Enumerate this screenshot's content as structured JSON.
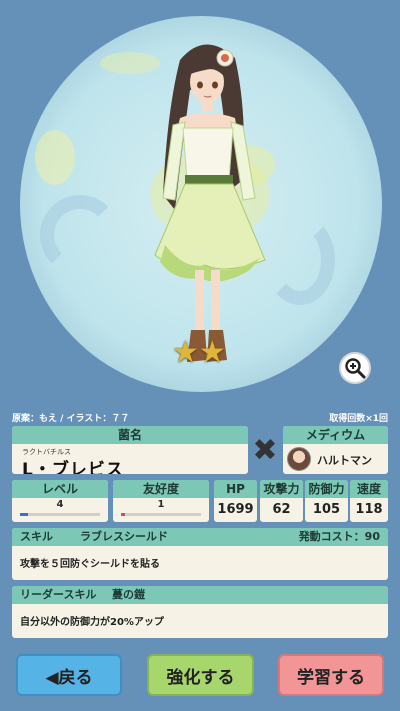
{
  "credits": {
    "left": "原案：もえ / イラスト：７７",
    "right": "取得回数×1回"
  },
  "character": {
    "name_label": "菌名",
    "name_ruby": "ラクトバチルス",
    "name": "L・ブレビス",
    "rarity_stars": 2,
    "stars_text": "★★"
  },
  "medium": {
    "label": "メディウム",
    "name": "ハルトマン"
  },
  "stats": {
    "level": {
      "label": "レベル",
      "value": "4",
      "bar_fraction": 0.1
    },
    "affinity": {
      "label": "友好度",
      "value": "1",
      "bar_fraction": 0.05
    },
    "hp": {
      "label": "HP",
      "value": "1699"
    },
    "attack": {
      "label": "攻撃力",
      "value": "62"
    },
    "defense": {
      "label": "防御力",
      "value": "105"
    },
    "speed": {
      "label": "速度",
      "value": "118"
    }
  },
  "skill": {
    "label": "スキル",
    "name": "ラブレスシールド",
    "cost": "発動コスト：90",
    "description": "攻撃を５回防ぐシールドを貼る"
  },
  "leader_skill": {
    "label": "リーダースキル",
    "name": "蔓の鎧",
    "description": "自分以外の防御力が20%アップ"
  },
  "buttons": {
    "back": "◀戻る",
    "enhance": "強化する",
    "learn": "学習する"
  },
  "icons": {
    "zoom": "zoom-in-icon",
    "cross": "cross-icon",
    "star": "star-icon"
  },
  "colors": {
    "panel_header": "#7cc7b6",
    "background": "#6590b8",
    "back": "#56b3e6",
    "enhance": "#a6d66c",
    "learn": "#f29596"
  }
}
